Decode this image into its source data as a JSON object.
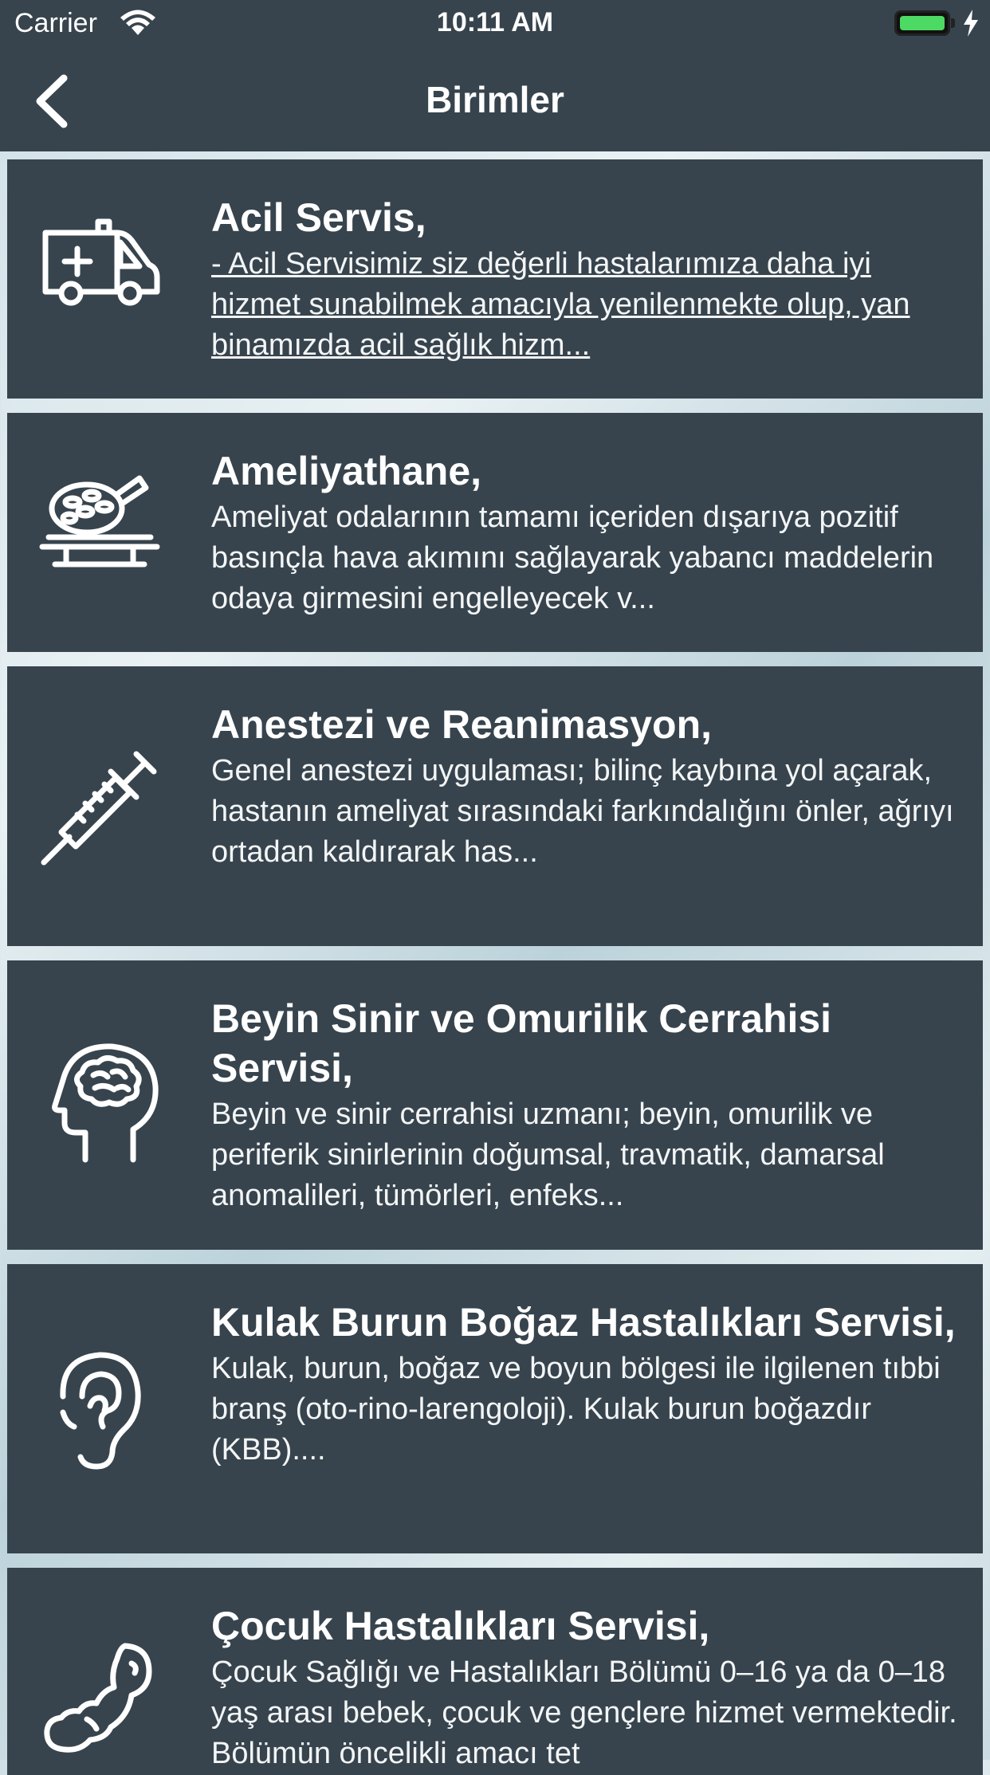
{
  "status_bar": {
    "carrier": "Carrier",
    "time": "10:11 AM",
    "battery_color": "#4cd964"
  },
  "nav": {
    "title": "Birimler",
    "back_icon": "chevron-left-icon"
  },
  "colors": {
    "card_bg": "#37444d",
    "text": "#ffffff"
  },
  "units": [
    {
      "icon": "ambulance-icon",
      "title": "Acil Servis,",
      "description": "- Acil Servisimiz siz değerli hastalarımıza daha iyi hizmet sunabilmek amacıyla yenilenmekte olup, yan binamızda acil sağlık hizm..."
    },
    {
      "icon": "operating-lamp-icon",
      "title": "Ameliyathane,",
      "description": "Ameliyat odalarının tamamı içeriden dışarıya pozitif basınçla hava akımını sağlayarak yabancı maddelerin odaya girmesini engelleyecek v..."
    },
    {
      "icon": "syringe-icon",
      "title": "Anestezi ve Reanimasyon,",
      "description": "Genel anestezi uygulaması; bilinç kaybına yol açarak, hastanın ameliyat sırasındaki farkındalığını önler, ağrıyı ortadan kaldırarak has..."
    },
    {
      "icon": "brain-head-icon",
      "title": "Beyin Sinir ve Omurilik Cerrahisi Servisi,",
      "description": "Beyin ve sinir cerrahisi uzmanı; beyin, omurilik ve periferik sinirlerinin doğumsal, travmatik, damarsal anomalileri, tümörleri, enfeks..."
    },
    {
      "icon": "ear-icon",
      "title": "Kulak Burun Boğaz Hastalıkları Servisi,",
      "description": "Kulak, burun, boğaz ve boyun bölgesi ile ilgilenen tıbbi branş (oto-rino-larengoloji). Kulak burun boğazdır (KBB)...."
    },
    {
      "icon": "baby-icon",
      "title": "Çocuk Hastalıkları Servisi,",
      "description": "Çocuk Sağlığı ve Hastalıkları Bölümü 0–16 ya da 0–18 yaş arası bebek, çocuk ve gençlere hizmet vermektedir. Bölümün öncelikli amacı tet"
    }
  ]
}
